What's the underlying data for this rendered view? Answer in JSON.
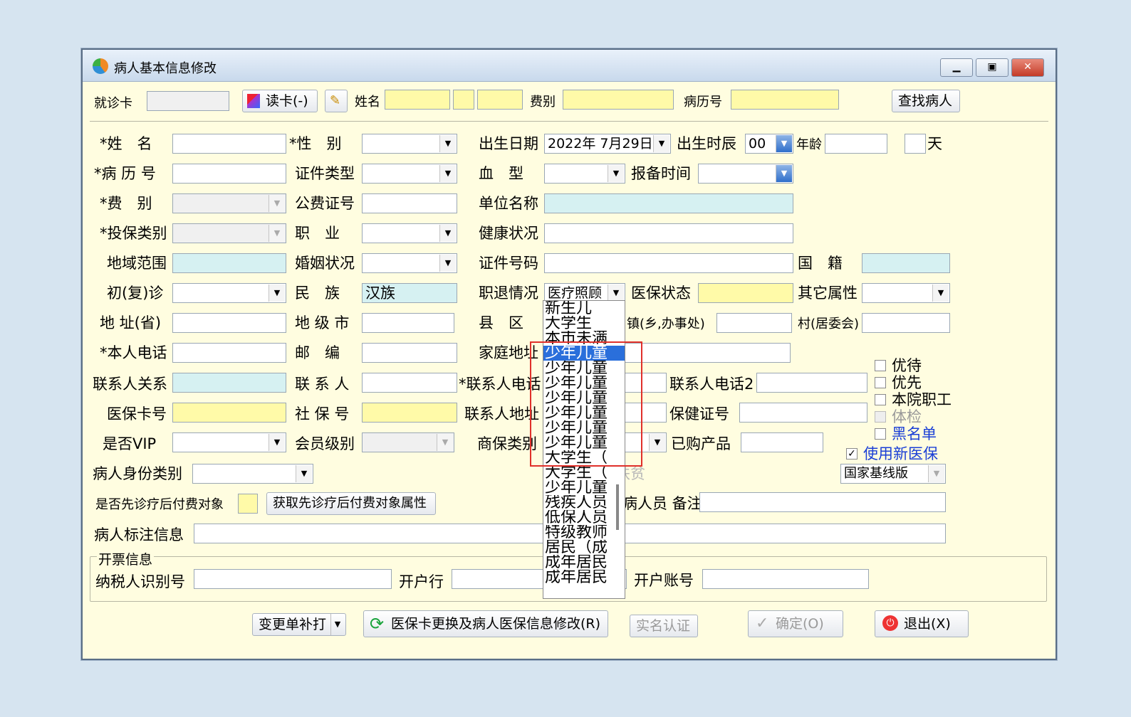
{
  "window": {
    "title": "病人基本信息修改",
    "buttons": [
      "▁",
      "▣",
      "✕"
    ]
  },
  "top": {
    "card_label": "就诊卡",
    "read_card": "读卡(-)",
    "name_label": "姓名",
    "fee_label": "费别",
    "record_label": "病历号",
    "search": "查找病人"
  },
  "form": {
    "name": "*姓　名",
    "gender": "*性　别",
    "birth": "出生日期",
    "birth_value": "2022年 7月29日",
    "birth_hour": "出生时辰",
    "birth_hour_value": "00",
    "age": "年龄",
    "day": "天",
    "record_no": "*病 历 号",
    "cert_type": "证件类型",
    "blood": "血　型",
    "report_time": "报备时间",
    "fee_type": "*费　别",
    "public_fee": "公费证号",
    "work_unit": "单位名称",
    "insure_type": "*投保类别",
    "job": "职　业",
    "health": "健康状况",
    "region": "地域范围",
    "marital": "婚姻状况",
    "cert_no": "证件号码",
    "nationality": "国　籍",
    "visit": "初(复)诊",
    "ethnic": "民　族",
    "ethnic_value": "汉族",
    "retire": "职退情况",
    "retire_value": "医疗照顾",
    "insure_status": "医保状态",
    "other_attr": "其它属性",
    "addr_prov": "地 址(省)",
    "city": "地 级 市",
    "county": "县　区",
    "town": "镇(乡,办事处)",
    "village": "村(居委会)",
    "phone": "*本人电话",
    "postcode": "邮　编",
    "home_addr": "家庭地址",
    "contact_rel": "联系人关系",
    "contact": "联 系 人",
    "contact_phone": "*联系人电话",
    "contact_phone2": "联系人电话2",
    "insure_card": "医保卡号",
    "social_no": "社 保 号",
    "contact_addr": "联系人地址",
    "health_cert": "保健证号",
    "vip": "是否VIP",
    "member_level": "会员级别",
    "biz_insure": "商保类别",
    "purchased": "已购产品",
    "identity": "病人身份类别",
    "poverty": "扶贫",
    "version_value": "国家基线版",
    "pay_later": "是否先诊疗后付费对象",
    "pay_later_btn": "获取先诊疗后付费对象属性",
    "staff_note": "病人员 备注",
    "mark_info": "病人标注信息"
  },
  "checks": [
    {
      "label": "优待",
      "checked": false,
      "color": "#000000",
      "enabled": true
    },
    {
      "label": "优先",
      "checked": false,
      "color": "#000000",
      "enabled": true
    },
    {
      "label": "本院职工",
      "checked": false,
      "color": "#000000",
      "enabled": true
    },
    {
      "label": "体检",
      "checked": false,
      "color": "#9a9a9a",
      "enabled": false
    },
    {
      "label": "黑名单",
      "checked": false,
      "color": "#1a3fd6",
      "enabled": true
    },
    {
      "label": "使用新医保",
      "checked": true,
      "color": "#1a3fd6",
      "enabled": true
    }
  ],
  "invoice": {
    "group_title": "开票信息",
    "tax_id": "纳税人识别号",
    "bank": "开户行",
    "account": "开户账号"
  },
  "dropdown": {
    "items": [
      "新生儿",
      "大学生",
      "本市未满",
      "少年儿童",
      "少年儿童",
      "少年儿童",
      "少年儿童",
      "少年儿童",
      "少年儿童",
      "少年儿童",
      "大学生（",
      "大学生（",
      "少年儿童",
      "残疾人员",
      "低保人员",
      "特级教师",
      "居民（成",
      "成年居民",
      "成年居民"
    ],
    "selected_index": 3
  },
  "bottom": {
    "reprint": "变更单补打",
    "change_card": "医保卡更换及病人医保信息修改(R)",
    "realname": "实名认证",
    "ok": "确定(O)",
    "exit": "退出(X)"
  }
}
